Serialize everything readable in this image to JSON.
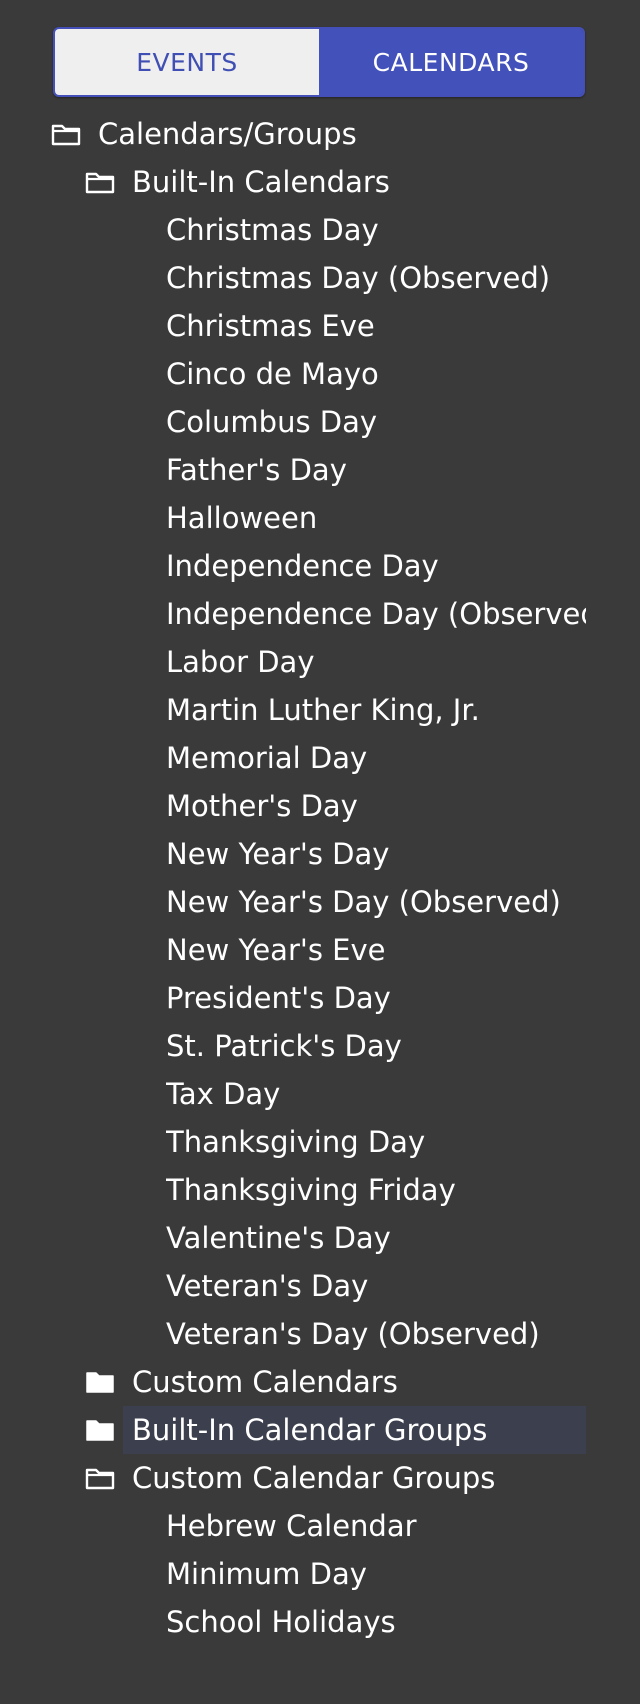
{
  "tabs": {
    "events": "EVENTS",
    "calendars": "CALENDARS",
    "active": "calendars"
  },
  "tree": {
    "root": {
      "label": "Calendars/Groups",
      "icon": "folder-open-icon"
    },
    "builtin_calendars": {
      "label": "Built-In Calendars",
      "icon": "folder-open-icon",
      "items": [
        "Christmas Day",
        "Christmas Day (Observed)",
        "Christmas Eve",
        "Cinco de Mayo",
        "Columbus Day",
        "Father's Day",
        "Halloween",
        "Independence Day",
        "Independence Day (Observed)",
        "Labor Day",
        "Martin Luther King, Jr.",
        "Memorial Day",
        "Mother's Day",
        "New Year's Day",
        "New Year's Day (Observed)",
        "New Year's Eve",
        "President's Day",
        "St. Patrick's Day",
        "Tax Day",
        "Thanksgiving Day",
        "Thanksgiving Friday",
        "Valentine's Day",
        "Veteran's Day",
        "Veteran's Day (Observed)"
      ]
    },
    "custom_calendars": {
      "label": "Custom Calendars",
      "icon": "folder-closed-icon"
    },
    "builtin_groups": {
      "label": "Built-In Calendar Groups",
      "icon": "folder-closed-icon",
      "selected": true
    },
    "custom_groups": {
      "label": "Custom Calendar Groups",
      "icon": "folder-open-icon",
      "items": [
        "Hebrew Calendar",
        "Minimum Day",
        "School Holidays"
      ]
    }
  },
  "colors": {
    "background": "#3a3a3a",
    "accent": "#4351bb",
    "tab_inactive_bg": "#efefef",
    "selected_row": "#3c3f4d"
  }
}
